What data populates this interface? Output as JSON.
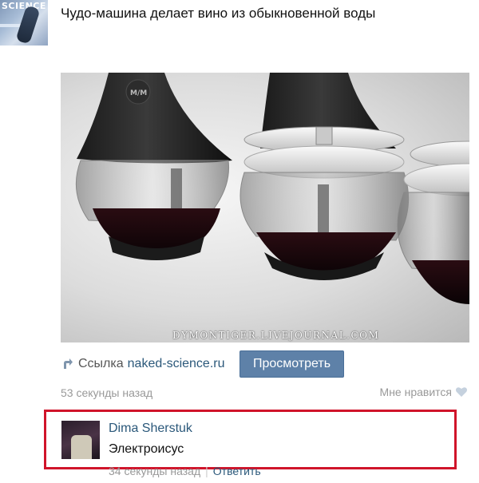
{
  "post": {
    "avatar_text": "SCIENCE",
    "title": "Чудо-машина делает вино из обыкновенной воды",
    "image": {
      "watermark": "DYMONTIGER.LIVEJOURNAL.COM",
      "device_logo": "M/M"
    },
    "link": {
      "prefix": "Ссылка",
      "domain": "naked-science.ru",
      "button_label": "Просмотреть"
    },
    "time": "53 секунды назад",
    "like_label": "Мне нравится"
  },
  "comment": {
    "author": "Dima Sherstuk",
    "text": "Электроисус",
    "time": "34 секунды назад",
    "separator": "|",
    "reply_label": "Ответить"
  },
  "colors": {
    "link": "#2b587a",
    "button": "#5e81a8",
    "muted": "#999999",
    "highlight_border": "#d0142a"
  }
}
